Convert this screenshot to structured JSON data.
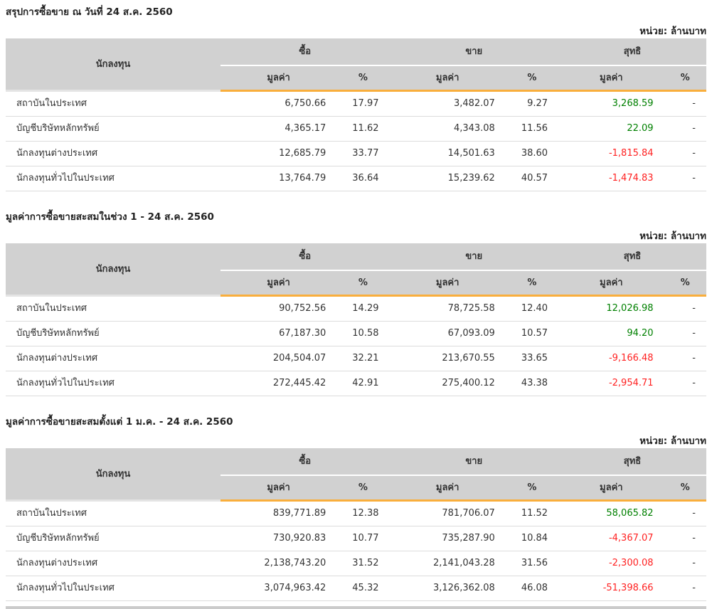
{
  "unit_label": "หน่วย: ล้านบาท",
  "columns": {
    "investor": "นักลงทุน",
    "buy": "ซื้อ",
    "sell": "ขาย",
    "net": "สุทธิ",
    "value": "มูลค่า",
    "percent": "%"
  },
  "colors": {
    "accent_orange": "#f9ae3c",
    "header_bg": "#d1d1d1",
    "positive_green": "#008000",
    "negative_red": "#ff2222",
    "row_divider": "#dcdcdc"
  },
  "sections": [
    {
      "title": "สรุปการซื้อขาย ณ วันที่ 24 ส.ค. 2560",
      "rows": [
        {
          "investor": "สถาบันในประเทศ",
          "buy_value": "6,750.66",
          "buy_pct": "17.97",
          "sell_value": "3,482.07",
          "sell_pct": "9.27",
          "net_value": "3,268.59",
          "net_trend": "positive",
          "net_pct": "-"
        },
        {
          "investor": "บัญชีบริษัทหลักทรัพย์",
          "buy_value": "4,365.17",
          "buy_pct": "11.62",
          "sell_value": "4,343.08",
          "sell_pct": "11.56",
          "net_value": "22.09",
          "net_trend": "positive",
          "net_pct": "-"
        },
        {
          "investor": "นักลงทุนต่างประเทศ",
          "buy_value": "12,685.79",
          "buy_pct": "33.77",
          "sell_value": "14,501.63",
          "sell_pct": "38.60",
          "net_value": "-1,815.84",
          "net_trend": "negative",
          "net_pct": "-"
        },
        {
          "investor": "นักลงทุนทั่วไปในประเทศ",
          "buy_value": "13,764.79",
          "buy_pct": "36.64",
          "sell_value": "15,239.62",
          "sell_pct": "40.57",
          "net_value": "-1,474.83",
          "net_trend": "negative",
          "net_pct": "-"
        }
      ]
    },
    {
      "title": "มูลค่าการซื้อขายสะสมในช่วง 1 - 24 ส.ค. 2560",
      "rows": [
        {
          "investor": "สถาบันในประเทศ",
          "buy_value": "90,752.56",
          "buy_pct": "14.29",
          "sell_value": "78,725.58",
          "sell_pct": "12.40",
          "net_value": "12,026.98",
          "net_trend": "positive",
          "net_pct": "-"
        },
        {
          "investor": "บัญชีบริษัทหลักทรัพย์",
          "buy_value": "67,187.30",
          "buy_pct": "10.58",
          "sell_value": "67,093.09",
          "sell_pct": "10.57",
          "net_value": "94.20",
          "net_trend": "positive",
          "net_pct": "-"
        },
        {
          "investor": "นักลงทุนต่างประเทศ",
          "buy_value": "204,504.07",
          "buy_pct": "32.21",
          "sell_value": "213,670.55",
          "sell_pct": "33.65",
          "net_value": "-9,166.48",
          "net_trend": "negative",
          "net_pct": "-"
        },
        {
          "investor": "นักลงทุนทั่วไปในประเทศ",
          "buy_value": "272,445.42",
          "buy_pct": "42.91",
          "sell_value": "275,400.12",
          "sell_pct": "43.38",
          "net_value": "-2,954.71",
          "net_trend": "negative",
          "net_pct": "-"
        }
      ]
    },
    {
      "title": "มูลค่าการซื้อขายสะสมตั้งแต่ 1 ม.ค. - 24 ส.ค. 2560",
      "rows": [
        {
          "investor": "สถาบันในประเทศ",
          "buy_value": "839,771.89",
          "buy_pct": "12.38",
          "sell_value": "781,706.07",
          "sell_pct": "11.52",
          "net_value": "58,065.82",
          "net_trend": "positive",
          "net_pct": "-"
        },
        {
          "investor": "บัญชีบริษัทหลักทรัพย์",
          "buy_value": "730,920.83",
          "buy_pct": "10.77",
          "sell_value": "735,287.90",
          "sell_pct": "10.84",
          "net_value": "-4,367.07",
          "net_trend": "negative",
          "net_pct": "-"
        },
        {
          "investor": "นักลงทุนต่างประเทศ",
          "buy_value": "2,138,743.20",
          "buy_pct": "31.52",
          "sell_value": "2,141,043.28",
          "sell_pct": "31.56",
          "net_value": "-2,300.08",
          "net_trend": "negative",
          "net_pct": "-"
        },
        {
          "investor": "นักลงทุนทั่วไปในประเทศ",
          "buy_value": "3,074,963.42",
          "buy_pct": "45.32",
          "sell_value": "3,126,362.08",
          "sell_pct": "46.08",
          "net_value": "-51,398.66",
          "net_trend": "negative",
          "net_pct": "-"
        }
      ]
    }
  ]
}
